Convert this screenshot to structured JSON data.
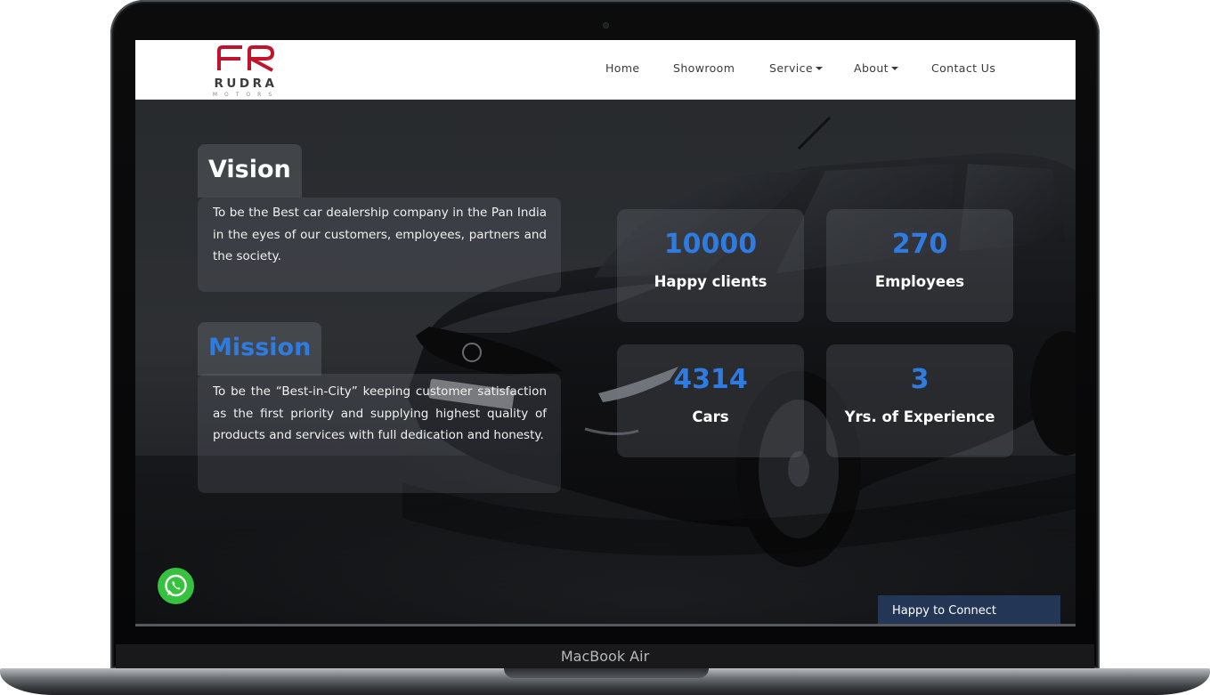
{
  "device": {
    "model_label": "MacBook Air"
  },
  "brand": {
    "name": "RUDRA",
    "sub": "MOTORS",
    "accent_color": "#c2132d"
  },
  "nav": {
    "items": [
      {
        "label": "Home",
        "dropdown": false
      },
      {
        "label": "Showroom",
        "dropdown": false
      },
      {
        "label": "Service",
        "dropdown": true
      },
      {
        "label": "About",
        "dropdown": true
      },
      {
        "label": "Contact Us",
        "dropdown": false
      }
    ]
  },
  "vision": {
    "title": "Vision",
    "text": "To be the Best car dealership company in the Pan India in the eyes of our customers, employees, partners and the society."
  },
  "mission": {
    "title": "Mission",
    "text": "To be the “Best-in-City” keeping customer satisfaction as the first priority and supplying highest quality of products and services with full dedication and honesty."
  },
  "stats": [
    {
      "value": "10000",
      "label": "Happy clients"
    },
    {
      "value": "270",
      "label": "Employees"
    },
    {
      "value": "4314",
      "label": "Cars"
    },
    {
      "value": "3",
      "label": "Yrs. of Experience"
    }
  ],
  "colors": {
    "stat_value": "#2f7be0",
    "mission_title": "#2f7be0",
    "whatsapp": "#36c13f",
    "connect_button": "#233656"
  },
  "whatsapp": {
    "icon": "whatsapp-icon"
  },
  "connect": {
    "label": "Happy to Connect"
  }
}
